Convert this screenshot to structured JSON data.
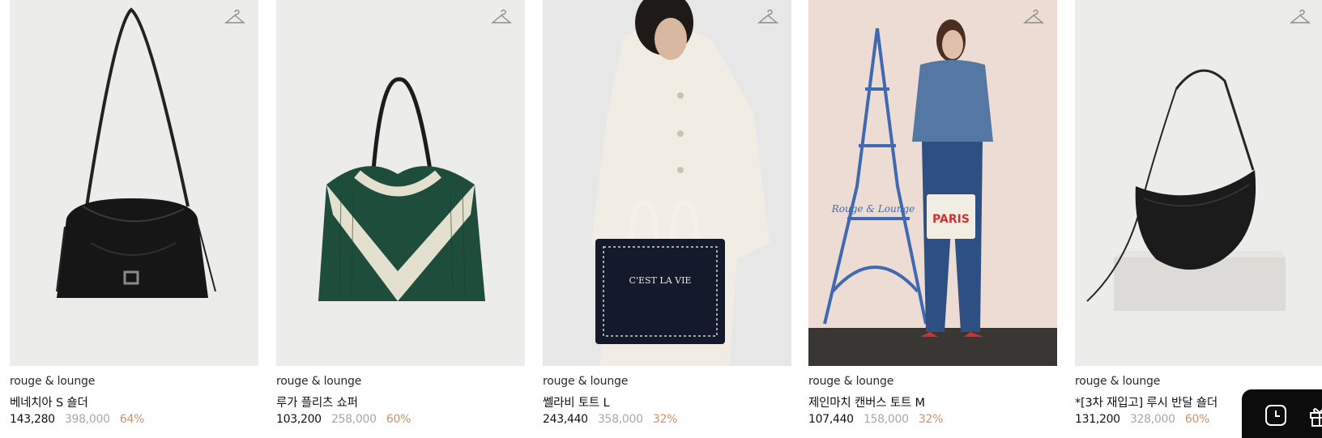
{
  "products": [
    {
      "brand": "rouge & lounge",
      "name": "베네치아 S 숄더",
      "sale_price": "143,280",
      "original_price": "398,000",
      "discount": "64%",
      "image": "black-drawstring-shoulder-bag"
    },
    {
      "brand": "rouge & lounge",
      "name": "루가 플리츠 쇼퍼",
      "sale_price": "103,200",
      "original_price": "258,000",
      "discount": "60%",
      "image": "green-pleated-shopper-bag"
    },
    {
      "brand": "rouge & lounge",
      "name": "쎌라비 토트 L",
      "sale_price": "243,440",
      "original_price": "358,000",
      "discount": "32%",
      "image": "model-with-navy-tote"
    },
    {
      "brand": "rouge & lounge",
      "name": "제인마치 캔버스 토트 M",
      "sale_price": "107,440",
      "original_price": "158,000",
      "discount": "32%",
      "image": "model-with-paris-canvas-tote"
    },
    {
      "brand": "rouge & lounge",
      "name": "*[3차 재입고] 루시 반달 숄더",
      "sale_price": "131,200",
      "original_price": "328,000",
      "discount": "60%",
      "image": "black-half-moon-bag"
    }
  ],
  "icons": {
    "wishlist": "hanger-icon",
    "recent": "clock-icon",
    "gift": "gift-icon"
  },
  "colors": {
    "discount": "#c8926a",
    "original_price": "#a8a8a8",
    "dock_background": "#0c0c0c"
  }
}
